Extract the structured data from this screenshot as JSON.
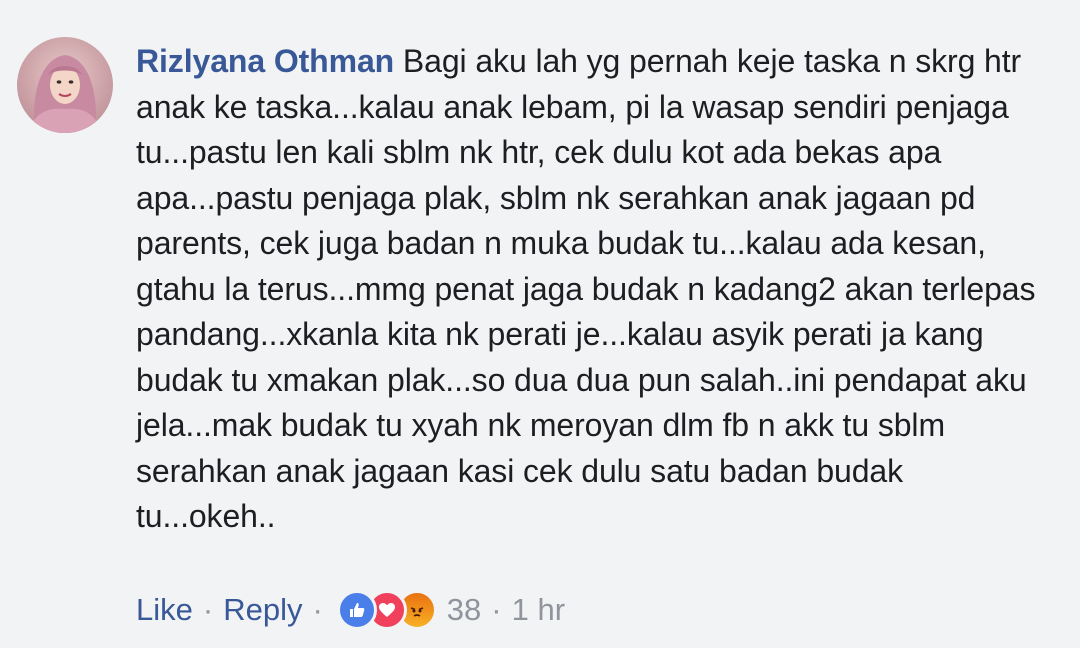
{
  "comment": {
    "author": "Rizlyana Othman",
    "text": "Bagi aku lah yg pernah keje taska n skrg htr anak ke taska...kalau anak lebam, pi la wasap sendiri penjaga tu...pastu len kali sblm nk htr, cek dulu kot ada bekas apa apa...pastu penjaga plak, sblm nk serahkan anak jagaan pd parents, cek juga badan n muka budak tu...kalau ada kesan, gtahu la terus...mmg penat jaga budak n kadang2 akan terlepas pandang...xkanla kita nk perati je...kalau asyik perati ja kang budak tu xmakan plak...so dua dua pun salah..ini pendapat aku jela...mak budak tu xyah nk meroyan dlm fb n akk tu sblm serahkan anak jagaan kasi cek dulu satu badan budak tu...okeh.."
  },
  "actions": {
    "like_label": "Like",
    "reply_label": "Reply",
    "separator": "·",
    "reaction_count": "38",
    "timestamp": "1 hr"
  },
  "reactions": [
    "like-icon",
    "love-icon",
    "angry-icon"
  ],
  "colors": {
    "author": "#385898",
    "text": "#1c1e21",
    "meta": "#90949c",
    "background": "#f2f3f5",
    "like": "#4a7ee8",
    "love": "#f0405b",
    "angry": "#f0891c"
  }
}
